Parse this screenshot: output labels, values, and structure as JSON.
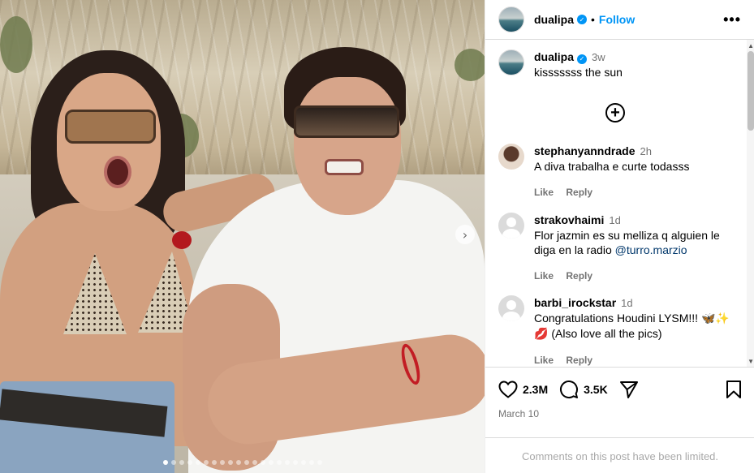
{
  "post": {
    "username": "dualipa",
    "verified_icon": "verified-badge-icon",
    "follow_label": "Follow",
    "more_icon": "more-options-icon",
    "carousel": {
      "total_slides": 20,
      "active_slide": 1
    },
    "next_icon": "chevron-right-icon"
  },
  "caption": {
    "username": "dualipa",
    "time": "3w",
    "text": "kisssssss the sun",
    "load_more_icon": "plus-circle-icon"
  },
  "comments": [
    {
      "username": "stephanyanndrade",
      "time": "2h",
      "text": "A diva trabalha e curte todasss",
      "like": "Like",
      "reply": "Reply"
    },
    {
      "username": "strakovhaimi",
      "time": "1d",
      "text": "Flor jazmin es su melliza q alguien le diga en la radio ",
      "mention": "@turro.marzio",
      "like": "Like",
      "reply": "Reply"
    },
    {
      "username": "barbi_irockstar",
      "time": "1d",
      "text": "Congratulations Houdini LYSM!!! ",
      "emoji1": "🦋✨",
      "emoji2": "💋",
      "text2": " (Also love all the pics)",
      "like": "Like",
      "reply": "Reply"
    }
  ],
  "stats": {
    "likes": "2.3M",
    "comments": "3.5K",
    "date": "March 10",
    "limited_text": "Comments on this post have been limited."
  },
  "colors": {
    "accent": "#0095f6",
    "muted": "#737373",
    "verified": "#0095f6"
  }
}
